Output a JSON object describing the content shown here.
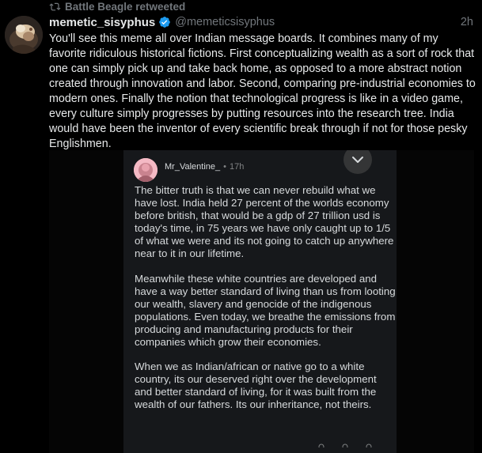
{
  "retweet": {
    "label": "Battle Beagle retweeted",
    "icon": "retweet-icon"
  },
  "author": {
    "display_name": "memetic_sisyphus",
    "handle": "@memeticsisyphus",
    "verified_icon": "verified-badge-icon",
    "timestamp": "2h"
  },
  "tweet": {
    "text": "You'll see this meme all over Indian message boards. It combines many of my favorite ridiculous historical fictions. First conceptualizing wealth as a sort of rock that one can simply pick up and take back home, as opposed to a more abstract notion created through innovation and labor. Second, comparing pre-industrial economies to modern ones. Finally the notion that technological progress is like in a video game, every culture simply progresses by putting resources into the research tree. India would have been the inventor of every scientific break through if not for those pesky Englishmen."
  },
  "embed": {
    "username": "Mr_Valentine_",
    "separator": "•",
    "time": "17h",
    "menu_icon": "chevron-down-icon",
    "paragraphs": [
      "The bitter truth is that we can never rebuild what we have lost. India held 27 percent of the worlds economy before british, that would be a gdp of 27 trillion usd is today's time, in 75 years we have only caught up to 1/5 of what we were and its not going to catch up anywhere near to it in our lifetime.",
      "Meanwhile these white countries are developed and have a way better standard of living than us from looting our wealth, slavery and genocide of the indigenous populations. Even today, we breathe the emissions from producing and manufacturing products for their companies which grow their economies.",
      "When we as Indian/african or native go to a white country, its our deserved right over the development and better standard of living, for it was built from the wealth of our fathers. Its our inheritance, not theirs."
    ]
  },
  "colors": {
    "background": "#000000",
    "text_primary": "#e7e9ea",
    "text_secondary": "#71767b",
    "verified": "#1d9bf0",
    "card_bg": "#16181b"
  }
}
